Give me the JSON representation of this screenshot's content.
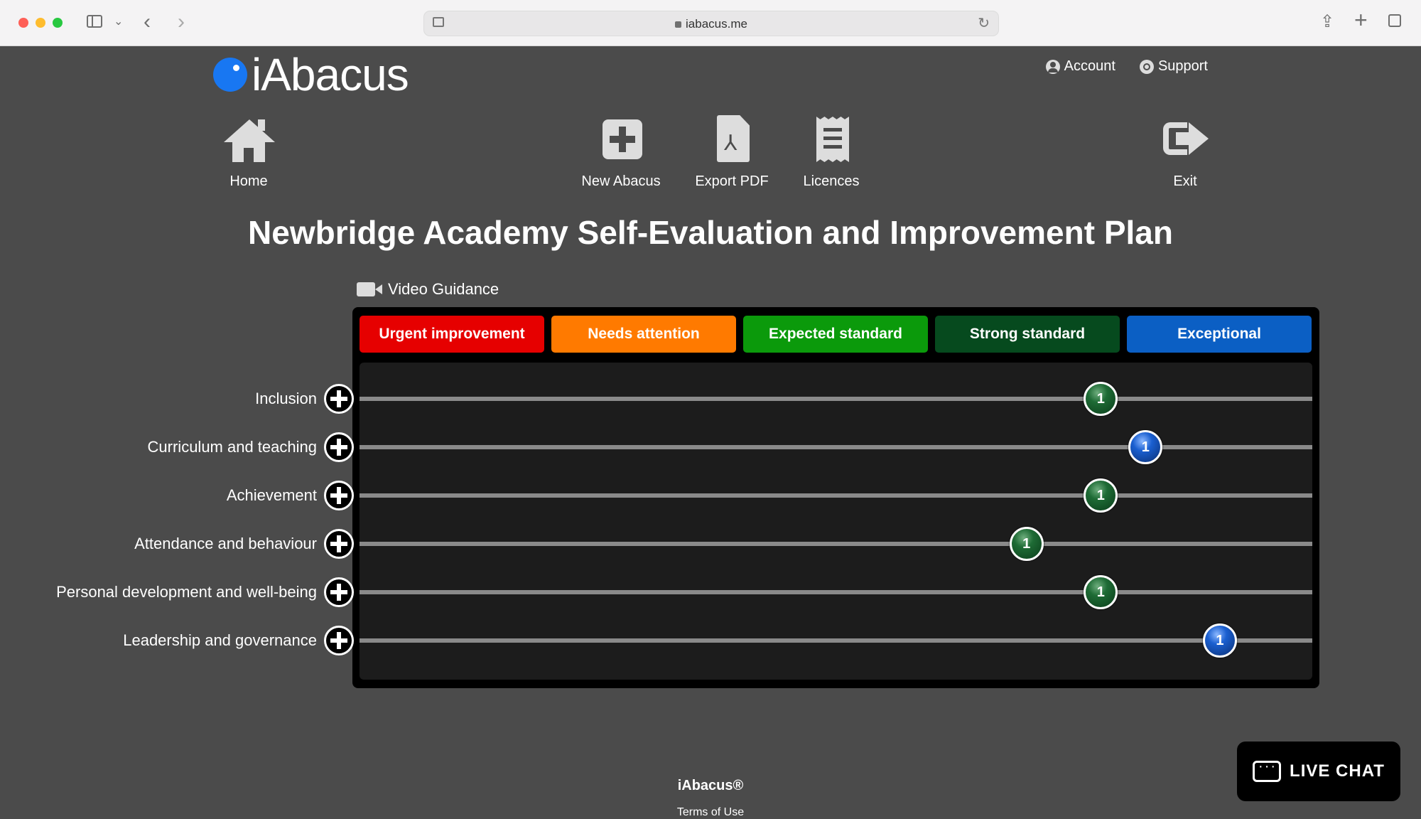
{
  "browser": {
    "url": "iabacus.me"
  },
  "brand": {
    "logo_text": "iAbacus"
  },
  "toplinks": {
    "account": "Account",
    "support": "Support"
  },
  "nav": {
    "home": "Home",
    "new_abacus": "New Abacus",
    "export_pdf": "Export PDF",
    "licences": "Licences",
    "exit": "Exit"
  },
  "page_title": "Newbridge Academy Self-Evaluation and Improvement Plan",
  "video_guidance": "Video Guidance",
  "scale": [
    {
      "label": "Urgent improvement",
      "color": "#e60000"
    },
    {
      "label": "Needs attention",
      "color": "#ff7a00"
    },
    {
      "label": "Expected standard",
      "color": "#0b9a0b"
    },
    {
      "label": "Strong standard",
      "color": "#064a1e"
    },
    {
      "label": "Exceptional",
      "color": "#0b5fc4"
    }
  ],
  "rows": [
    {
      "label": "Inclusion",
      "bead": "1",
      "bead_color": "green",
      "position_fraction": 0.778
    },
    {
      "label": "Curriculum and teaching",
      "bead": "1",
      "bead_color": "blue",
      "position_fraction": 0.825
    },
    {
      "label": "Achievement",
      "bead": "1",
      "bead_color": "green",
      "position_fraction": 0.778
    },
    {
      "label": "Attendance and behaviour",
      "bead": "1",
      "bead_color": "green",
      "position_fraction": 0.7
    },
    {
      "label": "Personal development and well-being",
      "bead": "1",
      "bead_color": "green",
      "position_fraction": 0.778
    },
    {
      "label": "Leadership and governance",
      "bead": "1",
      "bead_color": "blue",
      "position_fraction": 0.903
    }
  ],
  "footer": {
    "brand": "iAbacus®",
    "terms": "Terms of Use"
  },
  "live_chat": "LIVE CHAT"
}
